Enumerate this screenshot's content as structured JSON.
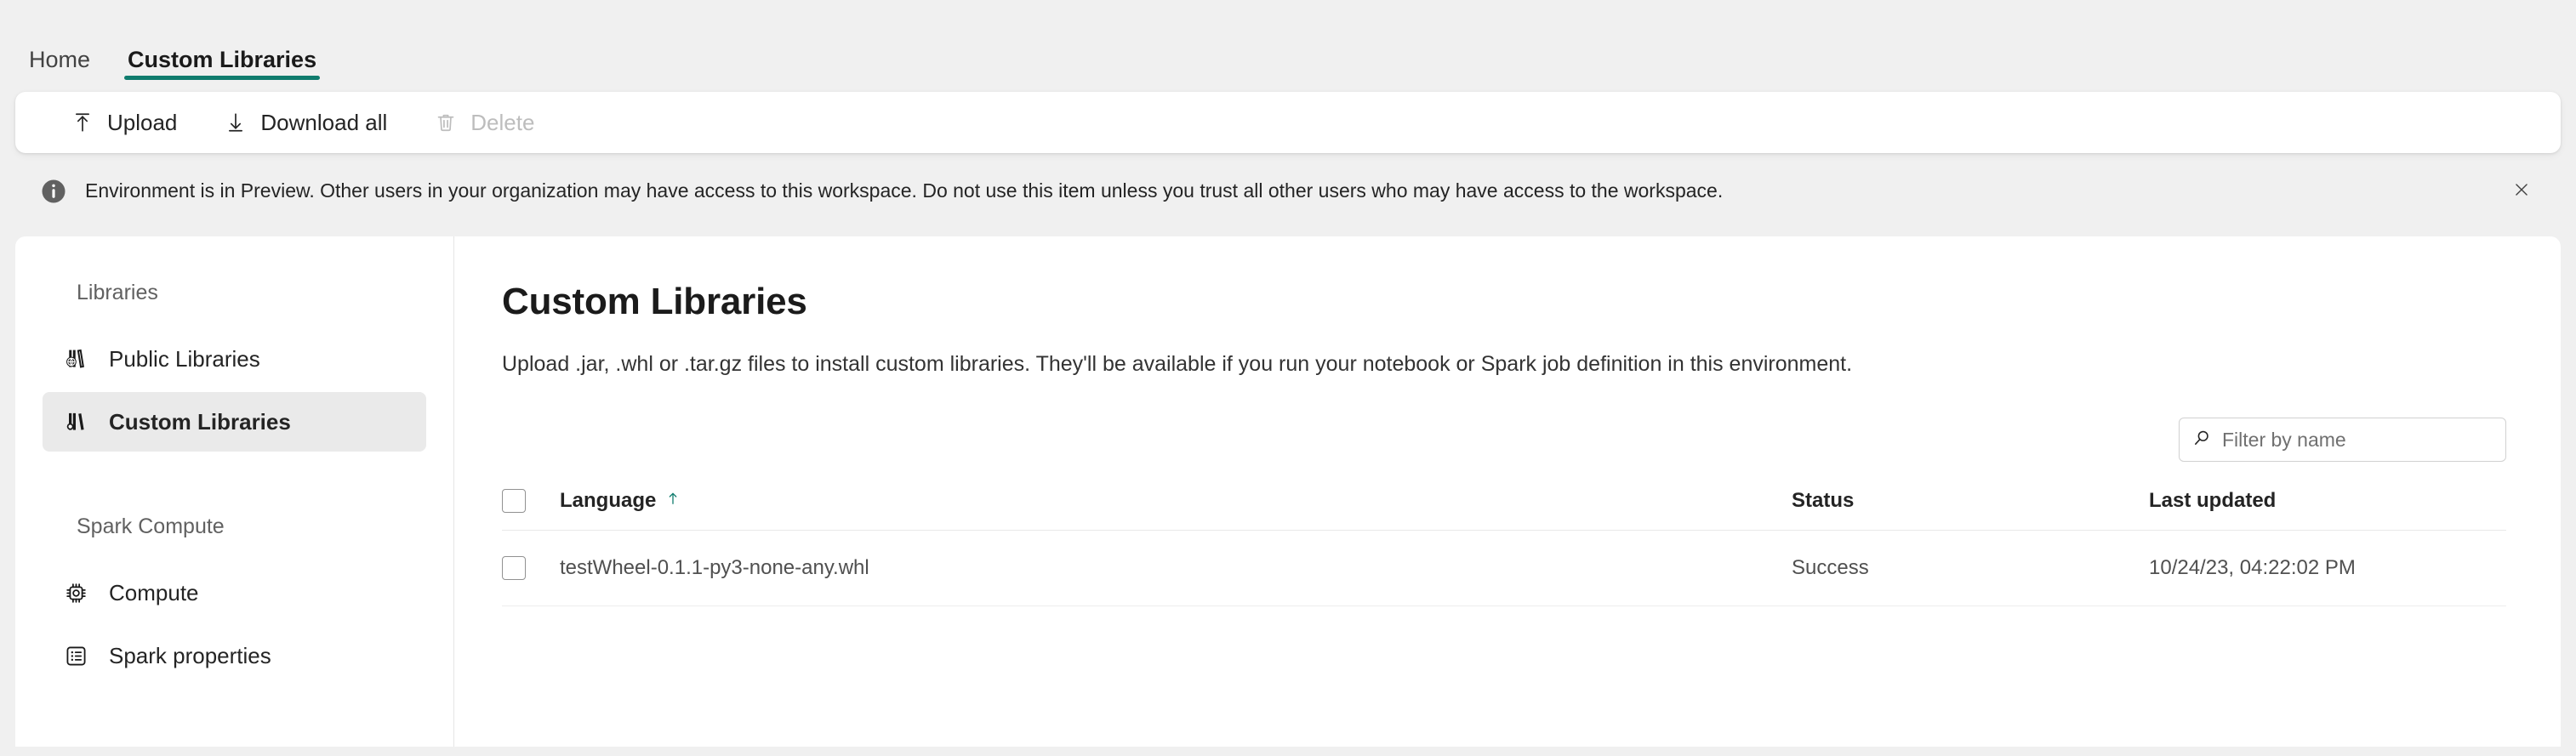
{
  "tabs": [
    {
      "label": "Home",
      "active": false
    },
    {
      "label": "Custom Libraries",
      "active": true
    }
  ],
  "toolbar": {
    "upload_label": "Upload",
    "download_all_label": "Download all",
    "delete_label": "Delete"
  },
  "banner": {
    "text": "Environment is in Preview. Other users in your organization may have access to this workspace. Do not use this item unless you trust all other users who may have access to the workspace."
  },
  "sidebar": {
    "groups": [
      {
        "title": "Libraries",
        "items": [
          {
            "label": "Public Libraries",
            "icon": "public-libraries-icon",
            "selected": false
          },
          {
            "label": "Custom Libraries",
            "icon": "custom-libraries-icon",
            "selected": true
          }
        ]
      },
      {
        "title": "Spark Compute",
        "items": [
          {
            "label": "Compute",
            "icon": "compute-chip-icon",
            "selected": false
          },
          {
            "label": "Spark properties",
            "icon": "list-properties-icon",
            "selected": false
          }
        ]
      }
    ]
  },
  "main": {
    "title": "Custom Libraries",
    "description": "Upload .jar, .whl or .tar.gz files to install custom libraries. They'll be available if you run your notebook or Spark job definition in this environment.",
    "search": {
      "placeholder": "Filter by name",
      "value": ""
    },
    "table": {
      "columns": [
        {
          "key": "language",
          "label": "Language",
          "sorted": "asc"
        },
        {
          "key": "status",
          "label": "Status",
          "sorted": ""
        },
        {
          "key": "updated",
          "label": "Last updated",
          "sorted": ""
        }
      ],
      "rows": [
        {
          "language": "testWheel-0.1.1-py3-none-any.whl",
          "status": "Success",
          "updated": "10/24/23, 04:22:02 PM",
          "selected": false
        }
      ]
    }
  },
  "colors": {
    "accent": "#107c6e",
    "page_background": "#f0f0f0",
    "card_background": "#ffffff",
    "selected_item_background": "#eaeaea",
    "text_primary": "#242424",
    "text_secondary": "#616161",
    "disabled_text": "#bdbdbd"
  }
}
